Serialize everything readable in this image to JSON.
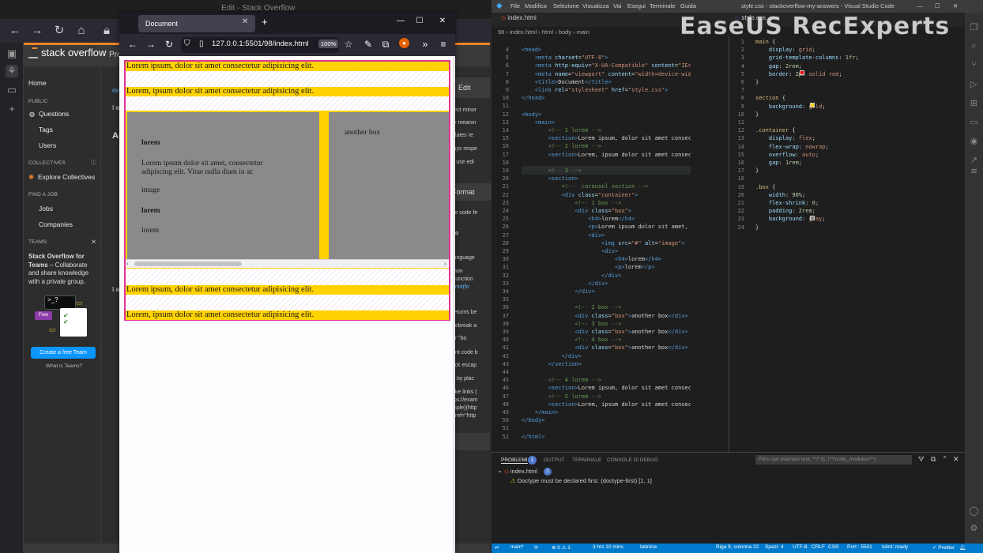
{
  "so_window": {
    "tab_title": "Edit - Stack Overflow",
    "brand": "stack overflow",
    "products": "Pro",
    "sidebar": {
      "home": "Home",
      "public_head": "PUBLIC",
      "questions": "Questions",
      "tags": "Tags",
      "users": "Users",
      "collectives_head": "COLLECTIVES",
      "explore_collectives": "Explore Collectives",
      "find_job_head": "FIND A JOB",
      "jobs": "Jobs",
      "companies": "Companies",
      "teams_head": "TEAMS",
      "teams_title": "Stack Overflow for Teams",
      "teams_desc": "– Collaborate and share knowledge with a private group.",
      "free_badge": "Free",
      "create_team": "Create a free Team",
      "what_is_teams": "What is Teams?"
    },
    "fragments": [
      "rect minor",
      "fy meanin",
      "elates re",
      "lays respe",
      "'t use edi",
      "ite code fe",
      "so",
      "language",
      "thon",
      "Function",
      "print(fo",
      "returns be",
      "nebreak a",
      "or \"bo",
      "ent code b",
      "tick escap",
      "e by plac",
      "ake links (",
      "tps://exam",
      "mple)(http",
      "href=\"http"
    ],
    "edit_button": "Edit",
    "format_button": "Format"
  },
  "firefox": {
    "tab_title": "Document",
    "url": "127.0.0.1:5501/98/index.html",
    "zoom": "100%",
    "page": {
      "section1": "Lorem ipsum, dolor sit amet consectetur adipisicing elit.",
      "section2": "Lorem, ipsum dolor sit amet consectetur adipisicing elit.",
      "box1_h4_top": "lorem",
      "box1_p": "Lorem ipsum dolor sit amet, consectetur adipiscing elit. Vitae nulla diam in ac",
      "box1_img": "image",
      "box1_h4": "lorem",
      "box1_p2": "lorem",
      "box2_text": "another box",
      "section4": "Lorem ipsum, dolor sit amet consectetur adipisicing elit.",
      "section5": "Lorem, ipsum dolor sit amet consectetur adipisicing elit."
    }
  },
  "vscode": {
    "menu": [
      "File",
      "Modifica",
      "Selezione",
      "Visualizza",
      "Vai",
      "Esegui",
      "Terminale",
      "Guida"
    ],
    "window_title": "style.css - stackoverflow-my-answers - Visual Studio Code",
    "tab_html": "index.html",
    "tab_css": "style.css",
    "breadcrumb": "98 › index.html › html › body › main",
    "watermark": "EaseUS RecExperts",
    "html_lines": [
      {
        "n": "4",
        "t": [
          [
            "tag",
            "<head>"
          ]
        ]
      },
      {
        "n": "5",
        "t": [
          [
            "tag",
            "    <meta "
          ],
          [
            "attr",
            "charset"
          ],
          [
            "txt",
            "="
          ],
          [
            "str",
            "\"UTF-8\""
          ],
          [
            "tag",
            ">"
          ]
        ]
      },
      {
        "n": "6",
        "t": [
          [
            "tag",
            "    <meta "
          ],
          [
            "attr",
            "http-equiv"
          ],
          [
            "txt",
            "="
          ],
          [
            "str",
            "\"X-UA-Compatible\""
          ],
          [
            "attr",
            " content"
          ],
          [
            "txt",
            "="
          ],
          [
            "str",
            "\"IE=e"
          ]
        ]
      },
      {
        "n": "7",
        "t": [
          [
            "tag",
            "    <meta "
          ],
          [
            "attr",
            "name"
          ],
          [
            "txt",
            "="
          ],
          [
            "str",
            "\"viewport\""
          ],
          [
            "attr",
            " content"
          ],
          [
            "txt",
            "="
          ],
          [
            "str",
            "\"width=device-widt"
          ]
        ]
      },
      {
        "n": "8",
        "t": [
          [
            "tag",
            "    <title>"
          ],
          [
            "txt",
            "Document"
          ],
          [
            "tag",
            "</title>"
          ]
        ]
      },
      {
        "n": "9",
        "t": [
          [
            "tag",
            "    <link "
          ],
          [
            "attr",
            "rel"
          ],
          [
            "txt",
            "="
          ],
          [
            "str",
            "\"stylesheet\""
          ],
          [
            "attr",
            " href"
          ],
          [
            "txt",
            "="
          ],
          [
            "str",
            "\"style.css\""
          ],
          [
            "tag",
            ">"
          ]
        ]
      },
      {
        "n": "10",
        "t": [
          [
            "tag",
            "</head>"
          ]
        ]
      },
      {
        "n": "11",
        "t": []
      },
      {
        "n": "12",
        "t": [
          [
            "tag",
            "<body>"
          ]
        ]
      },
      {
        "n": "13",
        "t": [
          [
            "tag",
            "    <main>"
          ]
        ]
      },
      {
        "n": "14",
        "t": [
          [
            "cm",
            "        <!-- 1 lorem -->"
          ]
        ]
      },
      {
        "n": "15",
        "t": [
          [
            "tag",
            "        <section>"
          ],
          [
            "txt",
            "Lorem ipsum, dolor sit amet consect"
          ]
        ]
      },
      {
        "n": "16",
        "t": [
          [
            "cm",
            "        <!-- 2 lorem -->"
          ]
        ]
      },
      {
        "n": "17",
        "t": [
          [
            "tag",
            "        <section>"
          ],
          [
            "txt",
            "Lorem, ipsum dolor sit amet consect"
          ]
        ]
      },
      {
        "n": "18",
        "t": []
      },
      {
        "n": "19",
        "t": [
          [
            "cm",
            "        <!-- 3 -->"
          ]
        ]
      },
      {
        "n": "20",
        "t": [
          [
            "tag",
            "        <section>"
          ]
        ]
      },
      {
        "n": "21",
        "t": [
          [
            "cm",
            "            <!--  carousel section -->"
          ]
        ]
      },
      {
        "n": "22",
        "t": [
          [
            "tag",
            "            <div "
          ],
          [
            "attr",
            "class"
          ],
          [
            "txt",
            "="
          ],
          [
            "str",
            "\"container\""
          ],
          [
            "tag",
            ">"
          ]
        ]
      },
      {
        "n": "23",
        "t": [
          [
            "cm",
            "                <!-- 1 box -->"
          ]
        ]
      },
      {
        "n": "24",
        "t": [
          [
            "tag",
            "                <div "
          ],
          [
            "attr",
            "class"
          ],
          [
            "txt",
            "="
          ],
          [
            "str",
            "\"box\""
          ],
          [
            "tag",
            ">"
          ]
        ]
      },
      {
        "n": "25",
        "t": [
          [
            "tag",
            "                    <h4>"
          ],
          [
            "txt",
            "lorem"
          ],
          [
            "tag",
            "</h4>"
          ]
        ]
      },
      {
        "n": "26",
        "t": [
          [
            "tag",
            "                    <p>"
          ],
          [
            "txt",
            "Lorem ipsum dolor sit amet, c"
          ]
        ]
      },
      {
        "n": "27",
        "t": [
          [
            "tag",
            "                    <div>"
          ]
        ]
      },
      {
        "n": "28",
        "t": [
          [
            "tag",
            "                        <img "
          ],
          [
            "attr",
            "src"
          ],
          [
            "txt",
            "="
          ],
          [
            "str",
            "\"#\""
          ],
          [
            "attr",
            " alt"
          ],
          [
            "txt",
            "="
          ],
          [
            "str",
            "\"image\""
          ],
          [
            "tag",
            ">"
          ]
        ]
      },
      {
        "n": "29",
        "t": [
          [
            "tag",
            "                        <div>"
          ]
        ]
      },
      {
        "n": "30",
        "t": [
          [
            "tag",
            "                            <h4>"
          ],
          [
            "txt",
            "lorem"
          ],
          [
            "tag",
            "</h4>"
          ]
        ]
      },
      {
        "n": "31",
        "t": [
          [
            "tag",
            "                            <p>"
          ],
          [
            "txt",
            "lorem"
          ],
          [
            "tag",
            "</p>"
          ]
        ]
      },
      {
        "n": "32",
        "t": [
          [
            "tag",
            "                        </div>"
          ]
        ]
      },
      {
        "n": "33",
        "t": [
          [
            "tag",
            "                    </div>"
          ]
        ]
      },
      {
        "n": "34",
        "t": [
          [
            "tag",
            "                </div>"
          ]
        ]
      },
      {
        "n": "35",
        "t": []
      },
      {
        "n": "36",
        "t": [
          [
            "cm",
            "                <!-- 2 box -->"
          ]
        ]
      },
      {
        "n": "37",
        "t": [
          [
            "tag",
            "                <div "
          ],
          [
            "attr",
            "class"
          ],
          [
            "txt",
            "="
          ],
          [
            "str",
            "\"box\""
          ],
          [
            "tag",
            ">"
          ],
          [
            "txt",
            "another box"
          ],
          [
            "tag",
            "</div>"
          ]
        ]
      },
      {
        "n": "38",
        "t": [
          [
            "cm",
            "                <!-- 3 box -->"
          ]
        ]
      },
      {
        "n": "39",
        "t": [
          [
            "tag",
            "                <div "
          ],
          [
            "attr",
            "class"
          ],
          [
            "txt",
            "="
          ],
          [
            "str",
            "\"box\""
          ],
          [
            "tag",
            ">"
          ],
          [
            "txt",
            "another box"
          ],
          [
            "tag",
            "</div>"
          ]
        ]
      },
      {
        "n": "40",
        "t": [
          [
            "cm",
            "                <!-- 4 box -->"
          ]
        ]
      },
      {
        "n": "41",
        "t": [
          [
            "tag",
            "                <div "
          ],
          [
            "attr",
            "class"
          ],
          [
            "txt",
            "="
          ],
          [
            "str",
            "\"box\""
          ],
          [
            "tag",
            ">"
          ],
          [
            "txt",
            "another box"
          ],
          [
            "tag",
            "</div>"
          ]
        ]
      },
      {
        "n": "42",
        "t": [
          [
            "tag",
            "            </div>"
          ]
        ]
      },
      {
        "n": "43",
        "t": [
          [
            "tag",
            "        </section>"
          ]
        ]
      },
      {
        "n": "44",
        "t": []
      },
      {
        "n": "45",
        "t": [
          [
            "cm",
            "        <!-- 4 lorem -->"
          ]
        ]
      },
      {
        "n": "46",
        "t": [
          [
            "tag",
            "        <section>"
          ],
          [
            "txt",
            "Lorem ipsum, dolor sit amet consect"
          ]
        ]
      },
      {
        "n": "47",
        "t": [
          [
            "cm",
            "        <!-- 5 lorem -->"
          ]
        ]
      },
      {
        "n": "48",
        "t": [
          [
            "tag",
            "        <section>"
          ],
          [
            "txt",
            "Lorem, ipsum dolor sit amet consect"
          ]
        ]
      },
      {
        "n": "49",
        "t": [
          [
            "tag",
            "    </main>"
          ]
        ]
      },
      {
        "n": "50",
        "t": [
          [
            "tag",
            "</body>"
          ]
        ]
      },
      {
        "n": "51",
        "t": []
      },
      {
        "n": "52",
        "t": [
          [
            "tag",
            "</html>"
          ]
        ]
      }
    ],
    "css_lines": [
      {
        "n": "1",
        "t": [
          [
            "sel",
            "main "
          ],
          [
            "txt",
            "{"
          ]
        ]
      },
      {
        "n": "2",
        "t": [
          [
            "prop",
            "    display"
          ],
          [
            "txt",
            ": "
          ],
          [
            "val",
            "grid"
          ],
          [
            "txt",
            ";"
          ]
        ]
      },
      {
        "n": "3",
        "t": [
          [
            "prop",
            "    grid-template-columns"
          ],
          [
            "txt",
            ": "
          ],
          [
            "num",
            "1fr"
          ],
          [
            "txt",
            ";"
          ]
        ]
      },
      {
        "n": "4",
        "t": [
          [
            "prop",
            "    gap"
          ],
          [
            "txt",
            ": "
          ],
          [
            "num",
            "2rem"
          ],
          [
            "txt",
            ";"
          ]
        ]
      },
      {
        "n": "5",
        "t": [
          [
            "prop",
            "    border"
          ],
          [
            "txt",
            ": "
          ],
          [
            "num",
            "2px "
          ],
          [
            "val",
            "solid "
          ],
          [
            "val",
            "red"
          ],
          [
            "txt",
            ";"
          ]
        ]
      },
      {
        "n": "6",
        "t": [
          [
            "txt",
            "}"
          ]
        ]
      },
      {
        "n": "7",
        "t": []
      },
      {
        "n": "8",
        "t": [
          [
            "sel",
            "section "
          ],
          [
            "txt",
            "{"
          ]
        ]
      },
      {
        "n": "9",
        "t": [
          [
            "prop",
            "    background"
          ],
          [
            "txt",
            ": "
          ],
          [
            "val",
            "gold"
          ],
          [
            "txt",
            ";"
          ]
        ]
      },
      {
        "n": "10",
        "t": [
          [
            "txt",
            "}"
          ]
        ]
      },
      {
        "n": "11",
        "t": []
      },
      {
        "n": "12",
        "t": [
          [
            "sel",
            ".container "
          ],
          [
            "txt",
            "{"
          ]
        ]
      },
      {
        "n": "13",
        "t": [
          [
            "prop",
            "    display"
          ],
          [
            "txt",
            ": "
          ],
          [
            "val",
            "flex"
          ],
          [
            "txt",
            ";"
          ]
        ]
      },
      {
        "n": "14",
        "t": [
          [
            "prop",
            "    flex-wrap"
          ],
          [
            "txt",
            ": "
          ],
          [
            "val",
            "nowrap"
          ],
          [
            "txt",
            ";"
          ]
        ]
      },
      {
        "n": "15",
        "t": [
          [
            "prop",
            "    overflow"
          ],
          [
            "txt",
            ": "
          ],
          [
            "val",
            "auto"
          ],
          [
            "txt",
            ";"
          ]
        ]
      },
      {
        "n": "16",
        "t": [
          [
            "prop",
            "    gap"
          ],
          [
            "txt",
            ": "
          ],
          [
            "num",
            "1rem"
          ],
          [
            "txt",
            ";"
          ]
        ]
      },
      {
        "n": "17",
        "t": [
          [
            "txt",
            "}"
          ]
        ]
      },
      {
        "n": "18",
        "t": []
      },
      {
        "n": "19",
        "t": [
          [
            "sel",
            ".box "
          ],
          [
            "txt",
            "{"
          ]
        ]
      },
      {
        "n": "20",
        "t": [
          [
            "prop",
            "    width"
          ],
          [
            "txt",
            ": "
          ],
          [
            "num",
            "90%"
          ],
          [
            "txt",
            ";"
          ]
        ]
      },
      {
        "n": "21",
        "t": [
          [
            "prop",
            "    flex-shrink"
          ],
          [
            "txt",
            ": "
          ],
          [
            "num",
            "0"
          ],
          [
            "txt",
            ";"
          ]
        ]
      },
      {
        "n": "22",
        "t": [
          [
            "prop",
            "    padding"
          ],
          [
            "txt",
            ": "
          ],
          [
            "num",
            "2rem"
          ],
          [
            "txt",
            ";"
          ]
        ]
      },
      {
        "n": "23",
        "t": [
          [
            "prop",
            "    background"
          ],
          [
            "txt",
            ": "
          ],
          [
            "val",
            "gray"
          ],
          [
            "txt",
            ";"
          ]
        ]
      },
      {
        "n": "24",
        "t": [
          [
            "txt",
            "}"
          ]
        ]
      }
    ],
    "panel": {
      "tabs": [
        "PROBLEMI",
        "OUTPUT",
        "TERMINALE",
        "CONSOLE DI DEBUG"
      ],
      "problems_count": "1",
      "filter_placeholder": "Filtro (ad esempio text, **/*.ts, !**/node_modules/**)",
      "file": "index.html",
      "file_count": "1",
      "message": "Doctype must be declared first. (doctype-first) [1, 1]"
    },
    "status": {
      "branch": "main*",
      "errors": "⊗ 0 ⚠ 1",
      "time": "3 hrs 10 mins",
      "tabnine": "tabnine",
      "position": "Riga 9, colonna 22",
      "spaces": "Spazi: 4",
      "encoding": "UTF-8",
      "eol": "CRLF",
      "lang": "CSS",
      "port": "Port : 5501",
      "ready": "tslint: ready",
      "prettier": "✓ Prettier"
    }
  },
  "colors": {
    "gold": "#ffd200",
    "box_gray": "#8a8a8a",
    "main_border": "#e03394",
    "vs_status": "#007acc",
    "so_accent": "#f48225"
  }
}
